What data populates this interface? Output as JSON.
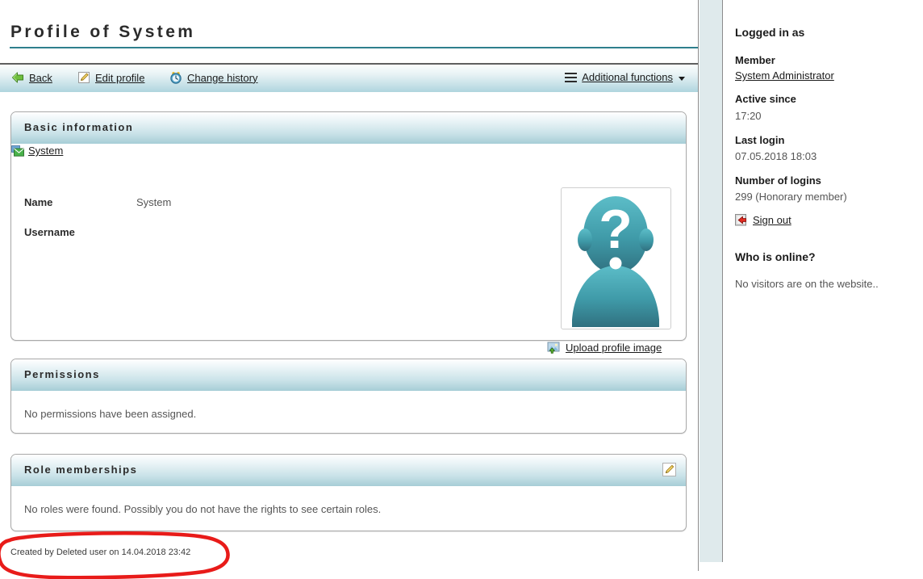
{
  "page": {
    "title": "Profile of System",
    "created_by": "Created by Deleted user on 14.04.2018 23:42"
  },
  "toolbar": {
    "back": {
      "label": "Back",
      "icon": "arrow-left-green-icon"
    },
    "edit_profile": {
      "label": "Edit profile",
      "icon": "pencil-page-icon"
    },
    "change_history": {
      "label": "Change history",
      "icon": "clock-icon"
    },
    "additional_functions": {
      "label": "Additional functions",
      "icon": "hamburger-icon",
      "caret": "chevron-down-icon"
    }
  },
  "panels": {
    "basic_information": {
      "title": "Basic information",
      "fields": [
        {
          "label": "Name",
          "value": "System"
        },
        {
          "label": "Username",
          "value": "System",
          "icon": "mail-icon"
        }
      ],
      "avatar": {
        "placeholder_glyph": "?",
        "alt": "profile-placeholder"
      },
      "upload_link": {
        "label": "Upload profile image",
        "icon": "upload-image-icon"
      }
    },
    "permissions": {
      "title": "Permissions",
      "body": "No permissions have been assigned."
    },
    "role_memberships": {
      "title": "Role memberships",
      "body": "No roles were found. Possibly you do not have the rights to see certain roles.",
      "edit_icon": "pencil-icon"
    }
  },
  "sidebar": {
    "logged_in_as": "Logged in as",
    "member_label": "Member",
    "member_name": "System Administrator",
    "active_since_label": "Active since",
    "active_since_value": "17:20",
    "last_login_label": "Last login",
    "last_login_value": "07.05.2018 18:03",
    "logins_label": "Number of logins",
    "logins_value": "299 (Honorary member)",
    "sign_out": {
      "label": "Sign out",
      "icon": "sign-out-icon"
    },
    "who_online_label": "Who is online?",
    "who_online_value": "No visitors are on the website.."
  },
  "colors": {
    "accent_teal": "#2e7f8d",
    "panel_header_bottom": "#a6cdd6",
    "toolbar_bottom": "#afd5de",
    "gutter": "#dfeaec",
    "annotation_red": "#e81b19"
  }
}
